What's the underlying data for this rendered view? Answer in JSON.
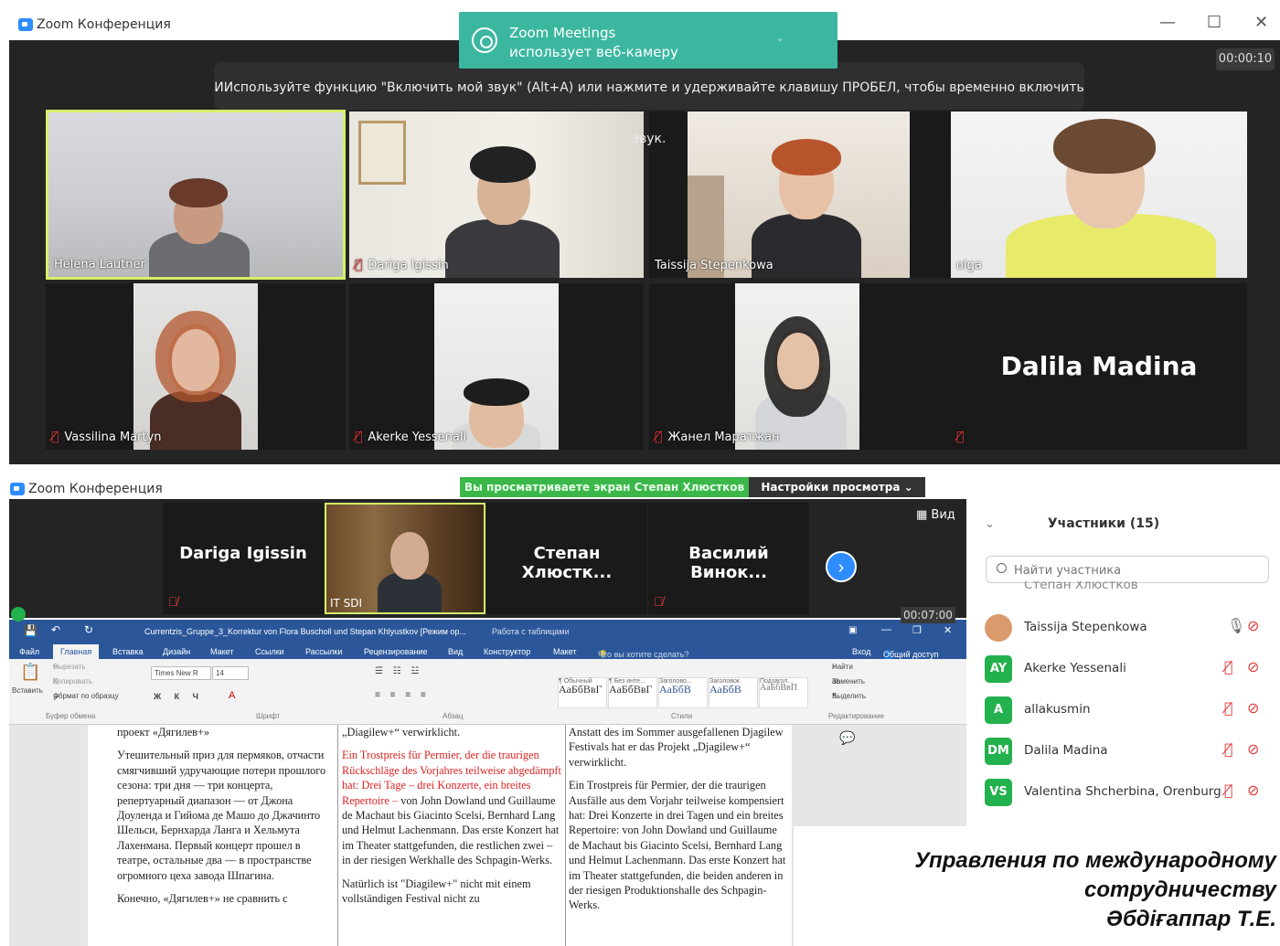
{
  "top_window": {
    "title": "Zoom Конференция",
    "notification": {
      "line1": "Zoom Meetings",
      "line2": "использует веб-камеру"
    },
    "hint": "ИИспользуйте функцию \"Включить мой звук\" (Alt+A) или нажмите и удерживайте клавишу ПРОБЕЛ, чтобы временно включить звук.",
    "timer": "00:00:10",
    "tiles": [
      {
        "name": "Helena Lautner",
        "muted": false,
        "active_speaker": true
      },
      {
        "name": "Dariga Igissin",
        "muted": true
      },
      {
        "name": "Taissija Stepenkowa",
        "muted": false
      },
      {
        "name": "olga",
        "muted": false
      },
      {
        "name": "Vassilina Martyn",
        "muted": true
      },
      {
        "name": "Akerke Yessenali",
        "muted": true
      },
      {
        "name": "Жанел Маратжан",
        "muted": true
      },
      {
        "name": "Dalila Madina",
        "muted": true,
        "video_off": true
      }
    ]
  },
  "bottom_window": {
    "title": "Zoom Конференция",
    "screen_banner": "Вы просматриваете экран Степан Хлюстков",
    "view_settings": "Настройки просмотра ⌄",
    "view_button": "Вид",
    "timer": "00:07:00",
    "strip": [
      {
        "name": "Dariga Igissin",
        "muted": true
      },
      {
        "name": "IT SDI",
        "muted": false,
        "video": true
      },
      {
        "name": "Степан  Хлюстк...",
        "muted": false
      },
      {
        "name": "Василий  Винок...",
        "muted": true
      }
    ],
    "word": {
      "doc_title": "Currentzis_Gruppe_3_Korrektur von Flora Buscholl und Stepan Khlyustkov [Режим ор...",
      "tools_title": "Работа с таблицами",
      "tabs": [
        "Файл",
        "Главная",
        "Вставка",
        "Дизайн",
        "Макет",
        "Ссылки",
        "Рассылки",
        "Рецензирование",
        "Вид",
        "Конструктор",
        "Макет"
      ],
      "tell_me": "Что вы хотите сделать?",
      "signin": "Вход",
      "share": "Общий доступ",
      "clipboard": {
        "paste": "Вставить",
        "cut": "Вырезать",
        "copy": "Копировать",
        "format": "Формат по образцу",
        "group": "Буфер обмена"
      },
      "font": {
        "name": "Times New R",
        "size": "14",
        "group": "Шрифт"
      },
      "paragraph_group": "Абзац",
      "styles": [
        {
          "sample": "АаБбВвГ",
          "label": "¶ Обычный"
        },
        {
          "sample": "АаБбВвГ",
          "label": "¶ Без инте..."
        },
        {
          "sample": "АаБбВ",
          "label": "Заголово..."
        },
        {
          "sample": "АаБбВ",
          "label": "Заголовок"
        },
        {
          "sample": "АаБбВвП",
          "label": "Подзагол..."
        }
      ],
      "styles_group": "Стили",
      "editing": {
        "find": "Найти",
        "replace": "Заменить",
        "select": "Выделить",
        "group": "Редактирование"
      },
      "col1": [
        "проект «Дягилев+»",
        "Утешительный приз для пермяков, отчасти смягчивший удручающие потери прошлого сезона: три дня — три концерта, репертуарный диапазон — от Джона Доуленда и Гийома де Машо до Джачинто Шельси, Бернхарда Ланга и Хельмута Лахенмана. Первый концерт прошел в театре, остальные два — в пространстве огромного цеха завода Шпагина.",
        "Конечно, «Дягилев+» не сравнить с"
      ],
      "col2_top": "„Diagilew+“ verwirklicht.",
      "col2_p_red": "Ein Trostpreis für Permier, der die traurigen Rückschläge des Vorjahres teilweise abgedämpft hat: Drei Tage – drei Konzerte, ein breites Repertoire –",
      "col2_p_black": "von John Dowland und Guillaume de Machaut bis Giacinto Scelsi, Bernhard Lang und Helmut Lachenmann. Das erste Konzert hat im Theater stattgefunden, die restlichen zwei – in der riesigen Werkhalle des Schpagin-Werks.",
      "col2_last": "Natürlich ist \"Diagilew+\" nicht mit einem vollständigen Festival nicht zu",
      "col3": [
        "Anstatt des im Sommer ausgefallenen Djagilew Festivals hat er das Projekt „Djagilew+“ verwirklicht.",
        "Ein Trostpreis für Permier, der die traurigen Ausfälle aus dem Vorjahr teilweise kompensiert hat: Drei Konzerte in drei Tagen und ein breites Repertoire: von John Dowland und Guillaume de Machaut bis Giacinto Scelsi, Bernhard Lang und Helmut Lachenmann. Das erste Konzert hat im Theater stattgefunden, die beiden anderen in der riesigen Produktionshalle des Schpagin-Werks."
      ]
    }
  },
  "participants_panel": {
    "title": "Участники (15)",
    "search_placeholder": "Найти участника",
    "partial_row": "Степан Хлюстков",
    "rows": [
      {
        "initials": "",
        "name": "Taissija Stepenkowa",
        "color": "#d99a6c",
        "photo": true,
        "muted": false
      },
      {
        "initials": "AY",
        "name": "Akerke Yessenali",
        "color": "#23b14d",
        "muted": true
      },
      {
        "initials": "A",
        "name": "allakusmin",
        "color": "#23b14d",
        "muted": true
      },
      {
        "initials": "DM",
        "name": "Dalila Madina",
        "color": "#23b14d",
        "muted": true
      },
      {
        "initials": "VS",
        "name": "Valentina Shcherbina, Orenburg",
        "color": "#23b14d",
        "muted": true
      }
    ]
  },
  "caption": {
    "line1": "Управления по международному",
    "line2": "сотрудничеству",
    "line3": "Әбдіғаппар Т.Е."
  }
}
